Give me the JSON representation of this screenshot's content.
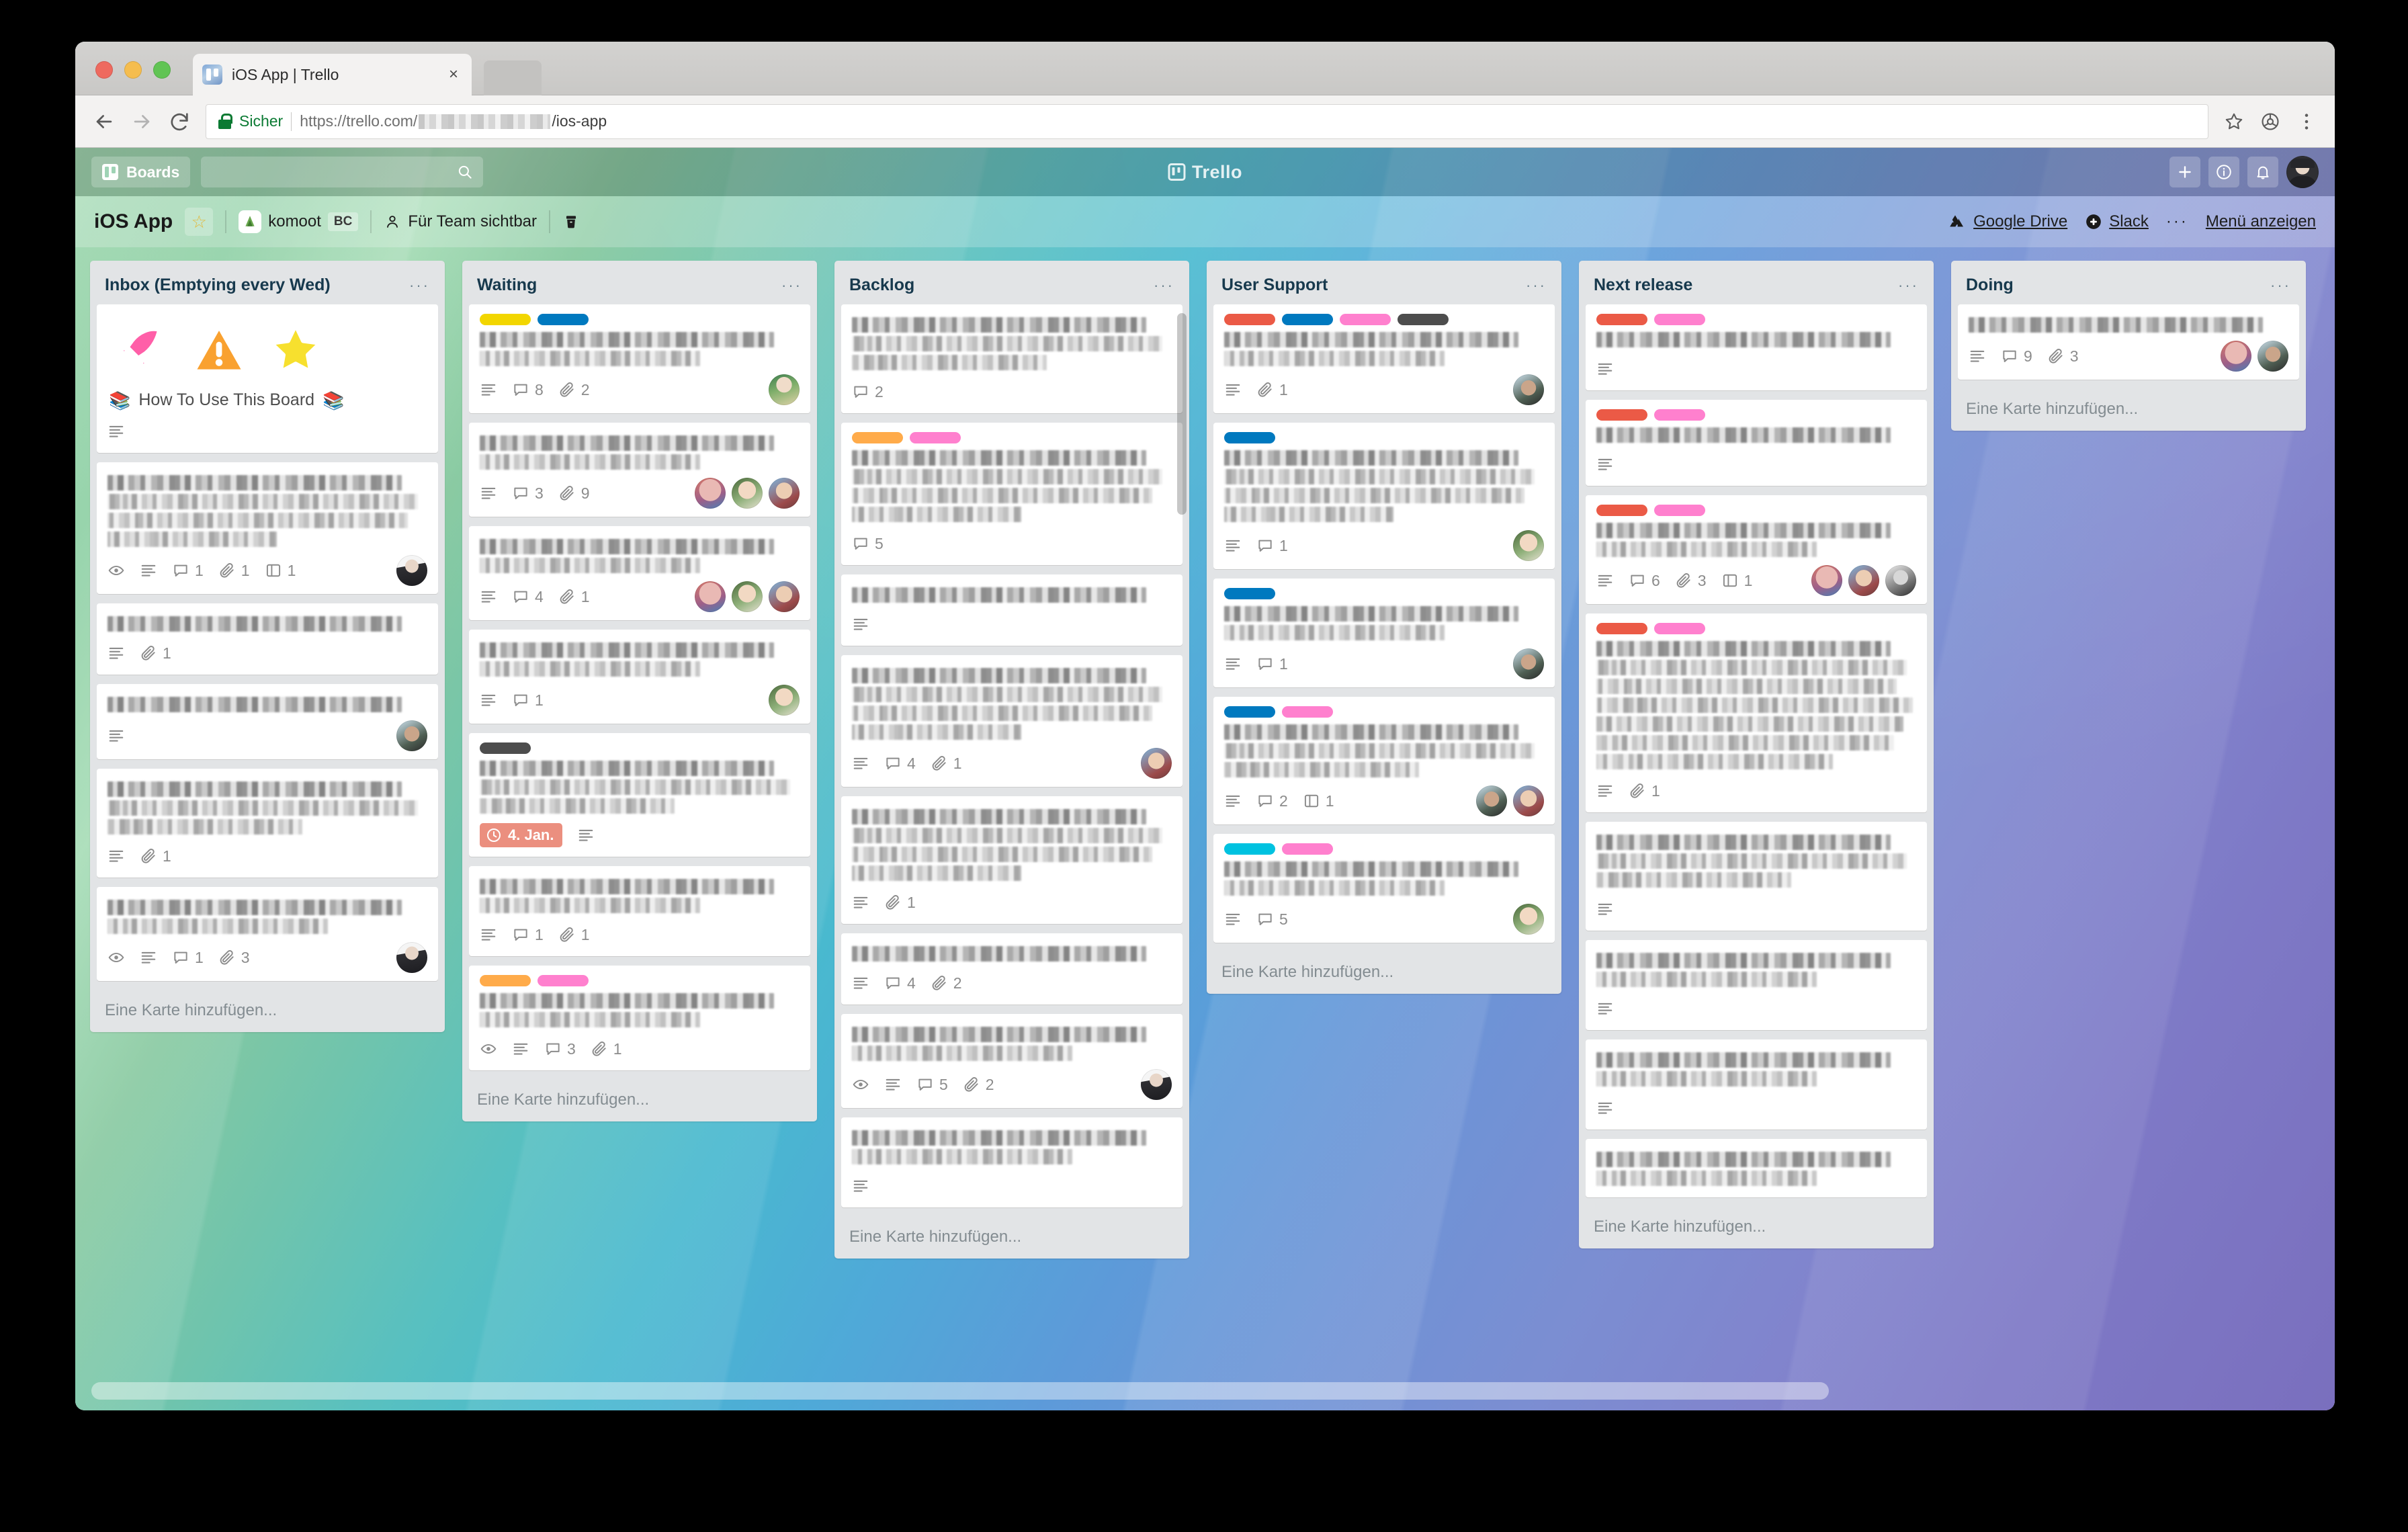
{
  "browser": {
    "tab": {
      "title": "iOS App | Trello",
      "favicon": "trello-favicon",
      "close_label": "×"
    },
    "omnibox": {
      "secure_label": "Sicher",
      "url_prefix": "https://trello.com/",
      "url_suffix": "/ios-app",
      "lock_icon": "lock-icon",
      "star_icon": "star-icon",
      "extension_icon": "extension-icon",
      "menu_icon": "kebab-menu-icon"
    },
    "nav": {
      "back": "back-arrow",
      "forward": "forward-arrow",
      "reload": "reload-icon"
    }
  },
  "trello_topbar": {
    "boards_label": "Boards",
    "search_placeholder": "",
    "search_value": "",
    "logo_text": "Trello",
    "buttons": [
      {
        "name": "add-button",
        "glyph": "+"
      },
      {
        "name": "info-button",
        "glyph": "i"
      },
      {
        "name": "notifications-button",
        "glyph": "bell"
      }
    ]
  },
  "board_header": {
    "title": "iOS App",
    "star_label": "☆",
    "team_name": "komoot",
    "team_initials": "BC",
    "visibility": "Für Team sichtbar",
    "archive_label": "",
    "links": [
      {
        "name": "google-drive-link",
        "label": "Google Drive"
      },
      {
        "name": "slack-link",
        "label": "Slack"
      }
    ],
    "menu_label": "Menü anzeigen",
    "menu_dots": "···"
  },
  "add_card_label": "Eine Karte hinzufügen...",
  "list_menu_dots": "···",
  "label_colors": {
    "red": "#eb5a46",
    "orange": "#ffab4a",
    "yellow": "#f2d600",
    "green": "#61bd4f",
    "blue": "#0079bf",
    "sky": "#00c2e0",
    "pink": "#ff80ce",
    "black": "#4d4d4d"
  },
  "lists": [
    {
      "title": "Inbox (Emptying every Wed)",
      "cards": [
        {
          "kind": "sticker",
          "stickers": [
            "rocket-sticker",
            "warning-sticker",
            "star-sticker"
          ],
          "title": "How To Use This Board",
          "title_prefix_icon": "books-emoji",
          "title_suffix_icon": "books-emoji",
          "badges": {
            "description": true
          }
        },
        {
          "kind": "redacted",
          "lines": 4,
          "badges": {
            "watching": true,
            "description": true,
            "comments": 1,
            "attachments": 1,
            "board": 1
          },
          "members": [
            "m-me"
          ]
        },
        {
          "kind": "redacted",
          "lines": 1,
          "badges": {
            "description": true,
            "attachments": 1
          },
          "members": []
        },
        {
          "kind": "redacted",
          "lines": 1,
          "badges": {
            "description": true
          },
          "members": [
            "m-sg"
          ]
        },
        {
          "kind": "redacted",
          "lines": 3,
          "badges": {
            "description": true,
            "attachments": 1
          },
          "members": []
        },
        {
          "kind": "redacted",
          "lines": 2,
          "badges": {
            "watching": true,
            "description": true,
            "comments": 1,
            "attachments": 3
          },
          "members": [
            "m-me"
          ]
        }
      ]
    },
    {
      "title": "Waiting",
      "cards": [
        {
          "kind": "redacted",
          "labels": [
            "yellow",
            "blue"
          ],
          "lines": 2,
          "badges": {
            "description": true,
            "comments": 8,
            "attachments": 2
          },
          "members": [
            "m-gb"
          ]
        },
        {
          "kind": "redacted",
          "lines": 2,
          "badges": {
            "description": true,
            "comments": 3,
            "attachments": 9
          },
          "members": [
            "m-pk",
            "m-gl",
            "m-bl"
          ]
        },
        {
          "kind": "redacted",
          "lines": 2,
          "badges": {
            "description": true,
            "comments": 4,
            "attachments": 1
          },
          "members": [
            "m-pk",
            "m-gl",
            "m-bl"
          ]
        },
        {
          "kind": "redacted",
          "lines": 2,
          "badges": {
            "description": true,
            "comments": 1
          },
          "members": [
            "m-gl"
          ]
        },
        {
          "kind": "redacted",
          "labels": [
            "black"
          ],
          "lines": 3,
          "badges": {
            "due": "4. Jan.",
            "description": true
          },
          "members": []
        },
        {
          "kind": "redacted",
          "lines": 2,
          "badges": {
            "description": true,
            "comments": 1,
            "attachments": 1
          },
          "members": []
        },
        {
          "kind": "redacted",
          "labels": [
            "orange",
            "pink"
          ],
          "lines": 2,
          "badges": {
            "watching": true,
            "description": true,
            "comments": 3,
            "attachments": 1
          },
          "members": []
        }
      ]
    },
    {
      "title": "Backlog",
      "cards": [
        {
          "kind": "redacted",
          "lines": 3,
          "badges": {
            "comments": 2
          },
          "members": []
        },
        {
          "kind": "redacted",
          "labels": [
            "orange",
            "pink"
          ],
          "lines": 4,
          "badges": {
            "comments": 5
          },
          "members": []
        },
        {
          "kind": "redacted",
          "lines": 1,
          "badges": {
            "description": true
          },
          "members": []
        },
        {
          "kind": "redacted",
          "lines": 4,
          "badges": {
            "description": true,
            "comments": 4,
            "attachments": 1
          },
          "members": [
            "m-bl"
          ]
        },
        {
          "kind": "redacted",
          "lines": 4,
          "badges": {
            "description": true,
            "attachments": 1
          },
          "members": []
        },
        {
          "kind": "redacted",
          "lines": 1,
          "badges": {
            "description": true,
            "comments": 4,
            "attachments": 2
          },
          "members": []
        },
        {
          "kind": "redacted",
          "lines": 2,
          "badges": {
            "watching": true,
            "description": true,
            "comments": 5,
            "attachments": 2
          },
          "members": [
            "m-me"
          ]
        },
        {
          "kind": "redacted",
          "lines": 2,
          "badges": {
            "description": true
          },
          "members": []
        }
      ]
    },
    {
      "title": "User Support",
      "cards": [
        {
          "kind": "redacted",
          "labels": [
            "red",
            "blue",
            "pink",
            "black"
          ],
          "lines": 2,
          "badges": {
            "description": true,
            "attachments": 1
          },
          "members": [
            "m-sg"
          ]
        },
        {
          "kind": "redacted",
          "labels": [
            "blue"
          ],
          "lines": 4,
          "badges": {
            "description": true,
            "comments": 1
          },
          "members": [
            "m-gl"
          ]
        },
        {
          "kind": "redacted",
          "labels": [
            "blue"
          ],
          "lines": 2,
          "badges": {
            "description": true,
            "comments": 1
          },
          "members": [
            "m-sg"
          ]
        },
        {
          "kind": "redacted",
          "labels": [
            "blue",
            "pink"
          ],
          "lines": 3,
          "badges": {
            "description": true,
            "comments": 2,
            "board": 1
          },
          "members": [
            "m-sg",
            "m-bl"
          ]
        },
        {
          "kind": "redacted",
          "labels": [
            "sky",
            "pink"
          ],
          "lines": 2,
          "badges": {
            "description": true,
            "comments": 5
          },
          "members": [
            "m-gl"
          ]
        }
      ]
    },
    {
      "title": "Next release",
      "cards": [
        {
          "kind": "redacted",
          "labels": [
            "red",
            "pink"
          ],
          "lines": 1,
          "badges": {
            "description": true
          },
          "members": []
        },
        {
          "kind": "redacted",
          "labels": [
            "red",
            "pink"
          ],
          "lines": 1,
          "badges": {
            "description": true
          },
          "members": []
        },
        {
          "kind": "redacted",
          "labels": [
            "red",
            "pink"
          ],
          "lines": 2,
          "badges": {
            "description": true,
            "comments": 6,
            "attachments": 3,
            "board": 1
          },
          "members": [
            "m-pk",
            "m-bl",
            "m-bw"
          ]
        },
        {
          "kind": "redacted",
          "labels": [
            "red",
            "pink"
          ],
          "lines": 7,
          "badges": {
            "description": true,
            "attachments": 1
          },
          "members": []
        },
        {
          "kind": "redacted",
          "lines": 3,
          "badges": {
            "description": true
          },
          "members": []
        },
        {
          "kind": "redacted",
          "lines": 2,
          "badges": {
            "description": true
          },
          "members": []
        },
        {
          "kind": "redacted",
          "lines": 2,
          "badges": {
            "description": true
          },
          "members": []
        },
        {
          "kind": "redacted",
          "lines": 2,
          "badges": {},
          "members": []
        }
      ]
    },
    {
      "title": "Doing",
      "cards": [
        {
          "kind": "redacted",
          "lines": 1,
          "badges": {
            "description": true,
            "comments": 9,
            "attachments": 3
          },
          "members": [
            "m-pk",
            "m-sg"
          ]
        }
      ]
    }
  ]
}
